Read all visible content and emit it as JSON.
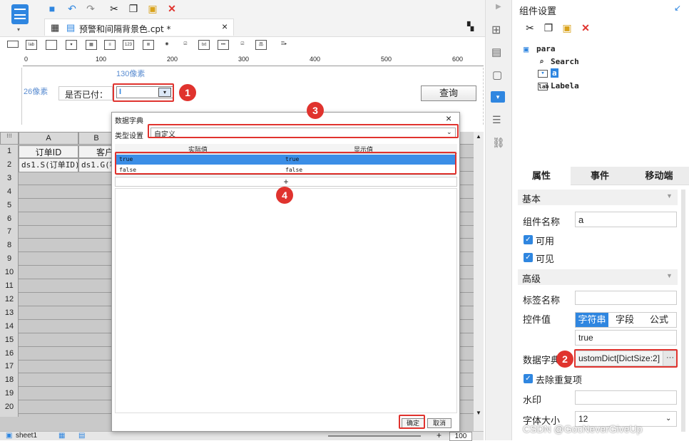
{
  "toolbar": {
    "tab_label": "预警和间隔背景色.cpt *",
    "tab_close": "×",
    "ruler_ticks": [
      "0",
      "100",
      "200",
      "300",
      "400",
      "500",
      "600"
    ]
  },
  "canvas": {
    "width_label": "130像素",
    "height_label": "26像素",
    "field_label": "是否已付：",
    "query_button": "查询",
    "field_value": "I"
  },
  "sheet": {
    "col_headers": [
      "A",
      "B"
    ],
    "row_numbers": [
      "1",
      "2",
      "3",
      "4",
      "5",
      "6",
      "7",
      "8",
      "9",
      "10",
      "11",
      "12",
      "13",
      "14",
      "15",
      "16",
      "17",
      "18",
      "19",
      "20"
    ],
    "row1": [
      "订单ID",
      "客户"
    ],
    "row2": [
      "ds1.S(订单ID)",
      "ds1.G(客"
    ],
    "sheet_tab": "sheet1",
    "zoom": "100"
  },
  "dialog": {
    "title": "数据字典",
    "close": "×",
    "type_label": "类型设置",
    "type_value": "自定义",
    "col_actual": "实际值",
    "col_display": "显示值",
    "rows": [
      {
        "actual": "true",
        "display": "true"
      },
      {
        "actual": "false",
        "display": "false"
      }
    ],
    "add": "+",
    "ok": "确定",
    "cancel": "取消"
  },
  "badges": [
    "1",
    "2",
    "3",
    "4"
  ],
  "panel": {
    "title": "组件设置",
    "tree": {
      "root": "para",
      "children": [
        "Search",
        "a",
        "Labela"
      ]
    },
    "tabs": [
      "属性",
      "事件",
      "移动端"
    ],
    "section_basic": "基本",
    "name_label": "组件名称",
    "name_value": "a",
    "enabled_label": "可用",
    "visible_label": "可见",
    "section_adv": "高级",
    "tag_label": "标签名称",
    "tag_value": "",
    "ctrl_label": "控件值",
    "ctrl_types": [
      "字符串",
      "字段",
      "公式"
    ],
    "ctrl_value": "true",
    "dict_label": "数据字典",
    "dict_value": "ustomDict[DictSize:2]",
    "dict_more": "···",
    "dedupe_label": "去除重复项",
    "watermark_label": "水印",
    "fontsize_label": "字体大小",
    "fontsize_value": "12"
  },
  "watermark": "CSDN @GocNeverGiveUp",
  "colors": {
    "accent": "#2f86e0",
    "red": "#e0332e",
    "selection": "#3b8ee6"
  }
}
